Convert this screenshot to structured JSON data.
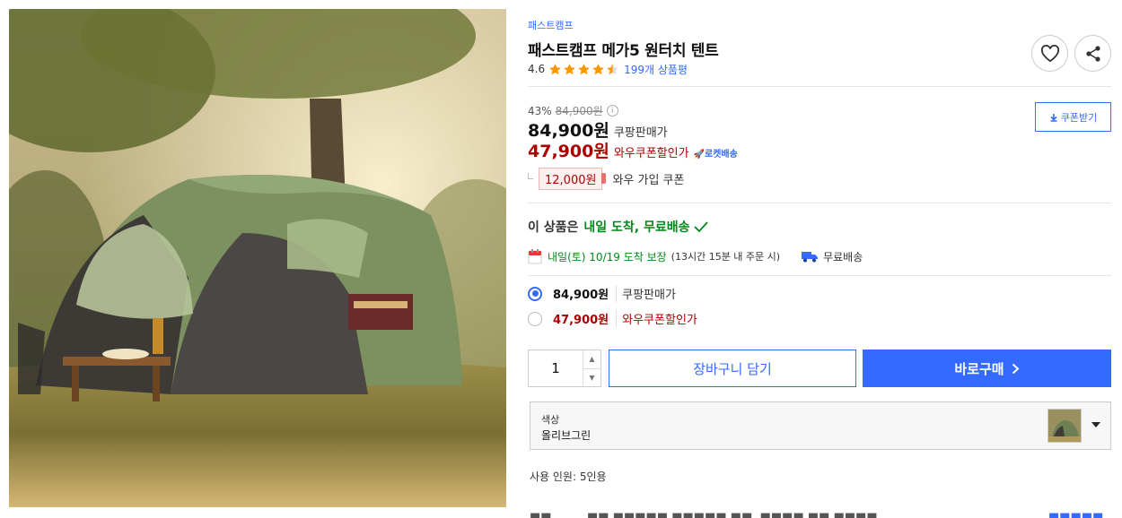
{
  "product": {
    "brand": "패스트캠프",
    "title": "패스트캠프 메가5 원터치 텐트",
    "rating": "4.6",
    "stars": 4.5,
    "review_count": "199개 상품평",
    "image_alt": "olive green pop-up tent in a meadow"
  },
  "actions": {
    "like_icon": "heart-icon",
    "share_icon": "share-icon",
    "coupon_button": "쿠폰받기"
  },
  "pricing": {
    "discount_rate": "43%",
    "original_price": "84,900원",
    "sale_price": "84,900원",
    "sale_label": "쿠팡판매가",
    "wow_price": "47,900원",
    "wow_label": "와우쿠폰할인가",
    "rocket_label": "로켓배송",
    "coupon_amount": "12,000원",
    "coupon_label": "와우 가입 쿠폰"
  },
  "delivery": {
    "headline_prefix": "이 상품은",
    "headline_highlight": "내일 도착, 무료배송",
    "date_text": "내일(토) 10/19 도착 보장",
    "note": "(13시간 15분 내 주문 시)",
    "free_shipping": "무료배송"
  },
  "options": [
    {
      "price": "84,900원",
      "label": "쿠팡판매가",
      "selected": true
    },
    {
      "price": "47,900원",
      "label": "와우쿠폰할인가",
      "selected": false
    }
  ],
  "purchase": {
    "quantity": "1",
    "cart_button": "장바구니 담기",
    "buy_button": "바로구매"
  },
  "color_option": {
    "label": "색상",
    "value": "올리브그린"
  },
  "capacity": "사용 인원: 5인용",
  "colors": {
    "accent": "#346aff",
    "wow_red": "#ae0000",
    "delivery_green": "#00891a",
    "star": "#ff9600"
  }
}
